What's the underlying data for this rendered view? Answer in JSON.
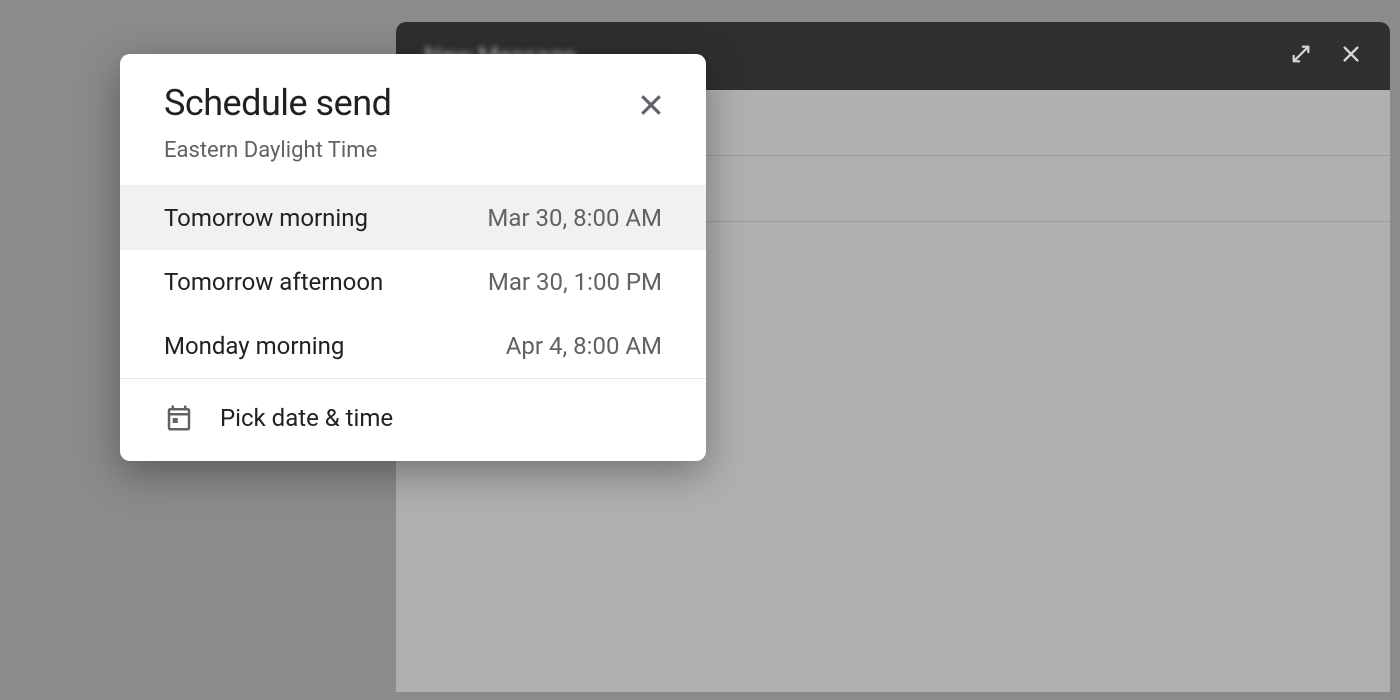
{
  "compose": {
    "title": "New Message"
  },
  "dialog": {
    "title": "Schedule send",
    "subtitle": "Eastern Daylight Time",
    "options": [
      {
        "label": "Tomorrow morning",
        "time": "Mar 30, 8:00 AM",
        "hovered": true
      },
      {
        "label": "Tomorrow afternoon",
        "time": "Mar 30, 1:00 PM",
        "hovered": false
      },
      {
        "label": "Monday morning",
        "time": "Apr 4, 8:00 AM",
        "hovered": false
      }
    ],
    "pick_label": "Pick date & time"
  }
}
